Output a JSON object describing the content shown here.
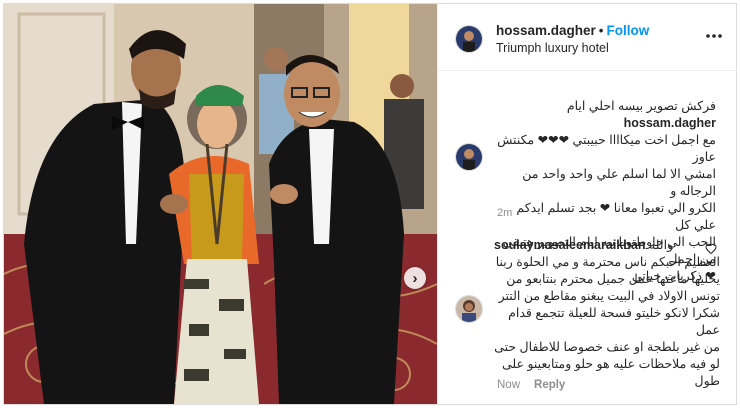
{
  "post": {
    "username": "hossam.dagher",
    "separator": "•",
    "follow_label": "Follow",
    "location": "Triumph luxury hotel",
    "more_icon": "more-horizontal-icon",
    "next_icon": "chevron-right-icon",
    "next_glyph": "›"
  },
  "caption": {
    "username": "hossam.dagher",
    "lines": [
      "فركش تصوير بيسه احلي ايام",
      "مع اجمل اخت ميكاااا حبيبتي ❤❤❤ مكنتش عاوز",
      "امشي الا لما اسلم علي واحد واحد من الرجاله و",
      "الكرو الي تعبوا معانا ❤ بجد تسلم ايدكم علي كل",
      "الحب الي حاوطتونا بيه ايام التصوير هتبقي من اجمل",
      "❤ ذكريات حياتي"
    ],
    "time": "2m"
  },
  "comment": {
    "username": "soulaymasaleemaraikhan",
    "lines": [
      "والله",
      "العظيم احبكم ناس محترمة و مي الحلوة ربنا",
      "يخليها ماعتها عمل جميل محترم بنتابعو من",
      "تونس الاولاد في البيت يبغنو مقاطع من التتر",
      "شكرا لانكو خليتو فسحة للعيلة تتجمع قدام عمل",
      "من غير بلطجة او عنف خصوصا للاطفال حتى",
      "لو فيه ملاحظات عليه هو حلو ومتابعينو على",
      "طول"
    ],
    "time": "Now",
    "reply_label": "Reply",
    "like_icon": "heart-outline-icon"
  }
}
